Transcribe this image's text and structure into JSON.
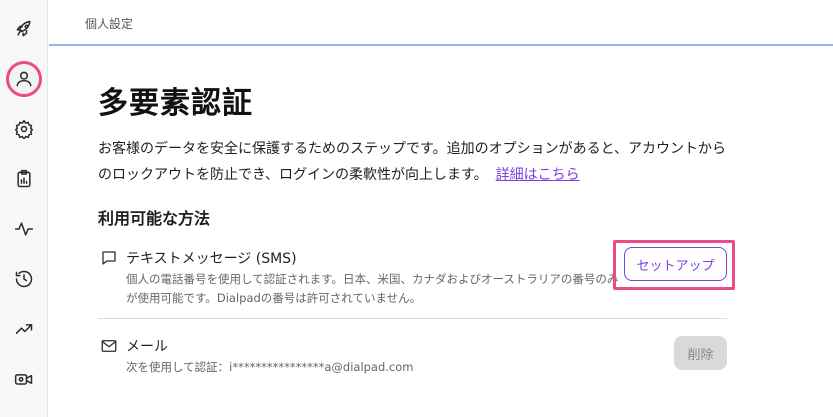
{
  "breadcrumb": "個人設定",
  "page": {
    "title": "多要素認証",
    "description": "お客様のデータを安全に保護するためのステップです。追加のオプションがあると、アカウントからのロックアウトを防止でき、ログインの柔軟性が向上します。",
    "details_link": "詳細はこちら"
  },
  "section": {
    "title": "利用可能な方法"
  },
  "methods": {
    "sms": {
      "name": "テキストメッセージ (SMS)",
      "description": "個人の電話番号を使用して認証されます。日本、米国、カナダおよびオーストラリアの番号のみが使用可能です。Dialpadの番号は許可されていません。",
      "action_label": "セットアップ"
    },
    "mail": {
      "name": "メール",
      "description": "次を使用して認証：i****************a@dialpad.com",
      "action_label": "削除"
    }
  },
  "sidebar": {
    "items": [
      {
        "icon": "rocket-icon"
      },
      {
        "icon": "user-icon",
        "active": true
      },
      {
        "icon": "gear-icon"
      },
      {
        "icon": "clipboard-chart-icon"
      },
      {
        "icon": "activity-icon"
      },
      {
        "icon": "history-icon"
      },
      {
        "icon": "trending-up-icon"
      },
      {
        "icon": "video-settings-icon"
      }
    ]
  },
  "colors": {
    "accent": "#7b3fe4",
    "highlight": "#ea4c89",
    "topbar_border": "#93b7ea"
  }
}
